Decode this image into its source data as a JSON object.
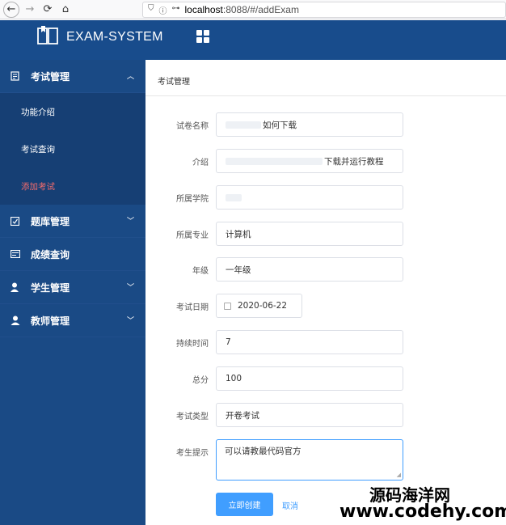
{
  "browser": {
    "url_host": "localhost",
    "url_rest": ":8088/#/addExam"
  },
  "header": {
    "app_title": "EXAM-SYSTEM"
  },
  "sidebar": {
    "groups": [
      {
        "label": "考试管理",
        "icon": "clipboard-icon",
        "expanded": true,
        "items": [
          {
            "label": "功能介绍"
          },
          {
            "label": "考试查询"
          },
          {
            "label": "添加考试",
            "active": true
          }
        ]
      },
      {
        "label": "题库管理",
        "icon": "question-bank-icon"
      },
      {
        "label": "成绩查询",
        "icon": "score-icon"
      },
      {
        "label": "学生管理",
        "icon": "student-icon"
      },
      {
        "label": "教师管理",
        "icon": "teacher-icon"
      }
    ]
  },
  "main": {
    "breadcrumb": "考试管理",
    "form": {
      "paper_name_label": "试卷名称",
      "paper_name_value": "如何下载",
      "intro_label": "介绍",
      "intro_value": "下载并运行教程",
      "college_label": "所属学院",
      "college_value": "",
      "major_label": "所属专业",
      "major_value": "计算机",
      "grade_label": "年级",
      "grade_value": "一年级",
      "date_label": "考试日期",
      "date_value": "2020-06-22",
      "duration_label": "持续时间",
      "duration_value": "7",
      "total_label": "总分",
      "total_value": "100",
      "type_label": "考试类型",
      "type_value": "开卷考试",
      "tips_label": "考生提示",
      "tips_value": "可以请教最代码官方",
      "submit_label": "立即创建",
      "cancel_label": "取消"
    }
  },
  "watermark": {
    "line1": "源码海洋网",
    "line2": "www.codehy.com"
  },
  "colors": {
    "header_bg": "#184c8c",
    "sidebar_bg": "#1a4a85",
    "primary": "#409eff",
    "active_menu": "#f56c6c"
  }
}
